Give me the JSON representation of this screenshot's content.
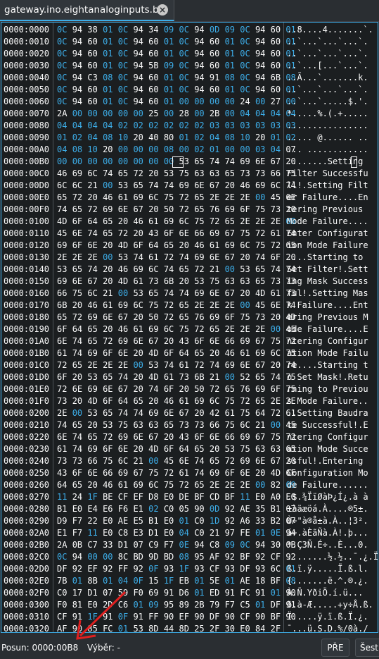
{
  "tab": {
    "title": "gateway.ino.eightanaloginputs.bin"
  },
  "hex_rows": [
    {
      "offset": "0000:0000",
      "bytes": [
        "0C",
        "94",
        "38",
        "01",
        "0C",
        "94",
        "34",
        "09",
        "0C",
        "94",
        "0D",
        "09",
        "0C",
        "94",
        "60",
        "01"
      ],
      "ascii": "..8....4.......`."
    },
    {
      "offset": "0000:0010",
      "bytes": [
        "0C",
        "94",
        "60",
        "01",
        "0C",
        "94",
        "60",
        "01",
        "0C",
        "94",
        "60",
        "01",
        "0C",
        "94",
        "60",
        "01"
      ],
      "ascii": "..`...`...`...`."
    },
    {
      "offset": "0000:0020",
      "bytes": [
        "0C",
        "94",
        "60",
        "01",
        "0C",
        "94",
        "60",
        "01",
        "0C",
        "94",
        "60",
        "01",
        "0C",
        "94",
        "60",
        "01"
      ],
      "ascii": "..`...`...`...`."
    },
    {
      "offset": "0000:0030",
      "bytes": [
        "0C",
        "94",
        "60",
        "01",
        "0C",
        "94",
        "5B",
        "09",
        "0C",
        "94",
        "60",
        "01",
        "0C",
        "94",
        "60",
        "01"
      ],
      "ascii": "..`...[...`...`."
    },
    {
      "offset": "0000:0040",
      "bytes": [
        "0C",
        "94",
        "C3",
        "08",
        "0C",
        "94",
        "60",
        "01",
        "0C",
        "94",
        "91",
        "08",
        "0C",
        "94",
        "6B",
        "08"
      ],
      "ascii": "..Ã...`.......k."
    },
    {
      "offset": "0000:0050",
      "bytes": [
        "0C",
        "94",
        "60",
        "01",
        "0C",
        "94",
        "60",
        "01",
        "0C",
        "94",
        "60",
        "01",
        "0C",
        "94",
        "60",
        "01"
      ],
      "ascii": "..`...`...`...`."
    },
    {
      "offset": "0000:0060",
      "bytes": [
        "0C",
        "94",
        "60",
        "01",
        "0C",
        "94",
        "60",
        "01",
        "00",
        "00",
        "00",
        "00",
        "24",
        "00",
        "27",
        "00"
      ],
      "ascii": "..`...`.....$.'."
    },
    {
      "offset": "0000:0070",
      "bytes": [
        "2A",
        "00",
        "00",
        "00",
        "00",
        "00",
        "25",
        "00",
        "28",
        "00",
        "2B",
        "00",
        "04",
        "04",
        "04",
        "04"
      ],
      "ascii": "*.....%.(.+....."
    },
    {
      "offset": "0000:0080",
      "bytes": [
        "04",
        "04",
        "04",
        "04",
        "02",
        "02",
        "02",
        "02",
        "02",
        "02",
        "03",
        "03",
        "03",
        "03",
        "03",
        "03"
      ],
      "ascii": "................"
    },
    {
      "offset": "0000:0090",
      "bytes": [
        "01",
        "02",
        "04",
        "08",
        "10",
        "20",
        "40",
        "80",
        "01",
        "02",
        "04",
        "08",
        "10",
        "20",
        "01",
        "02"
      ],
      "ascii": "..... @...... .."
    },
    {
      "offset": "0000:00A0",
      "bytes": [
        "04",
        "08",
        "10",
        "20",
        "00",
        "00",
        "00",
        "08",
        "00",
        "02",
        "01",
        "00",
        "00",
        "03",
        "04",
        "07"
      ],
      "ascii": "... ............"
    },
    {
      "offset": "0000:00B0",
      "bytes": [
        "00",
        "00",
        "00",
        "00",
        "00",
        "00",
        "00",
        "00",
        "53",
        "65",
        "74",
        "74",
        "69",
        "6E",
        "67",
        "20"
      ],
      "ascii": "........Setting "
    },
    {
      "offset": "0000:00C0",
      "bytes": [
        "46",
        "69",
        "6C",
        "74",
        "65",
        "72",
        "20",
        "53",
        "75",
        "63",
        "63",
        "65",
        "73",
        "73",
        "66",
        "75"
      ],
      "ascii": "Filter Successfu"
    },
    {
      "offset": "0000:00D0",
      "bytes": [
        "6C",
        "6C",
        "21",
        "00",
        "53",
        "65",
        "74",
        "74",
        "69",
        "6E",
        "67",
        "20",
        "46",
        "69",
        "6C",
        "74"
      ],
      "ascii": "ll!.Setting Filt"
    },
    {
      "offset": "0000:00E0",
      "bytes": [
        "65",
        "72",
        "20",
        "46",
        "61",
        "69",
        "6C",
        "75",
        "72",
        "65",
        "2E",
        "2E",
        "2E",
        "00",
        "45",
        "6E"
      ],
      "ascii": "er Failure....En"
    },
    {
      "offset": "0000:00F0",
      "bytes": [
        "74",
        "65",
        "72",
        "69",
        "6E",
        "67",
        "20",
        "50",
        "72",
        "65",
        "76",
        "69",
        "6F",
        "75",
        "73",
        "20"
      ],
      "ascii": "tering Previous "
    },
    {
      "offset": "0000:0100",
      "bytes": [
        "4D",
        "6F",
        "64",
        "65",
        "20",
        "46",
        "61",
        "69",
        "6C",
        "75",
        "72",
        "65",
        "2E",
        "2E",
        "2E",
        "00"
      ],
      "ascii": "Mode Failure...."
    },
    {
      "offset": "0000:0110",
      "bytes": [
        "45",
        "6E",
        "74",
        "65",
        "72",
        "20",
        "43",
        "6F",
        "6E",
        "66",
        "69",
        "67",
        "75",
        "72",
        "61",
        "74"
      ],
      "ascii": "Enter Configurat"
    },
    {
      "offset": "0000:0120",
      "bytes": [
        "69",
        "6F",
        "6E",
        "20",
        "4D",
        "6F",
        "64",
        "65",
        "20",
        "46",
        "61",
        "69",
        "6C",
        "75",
        "72",
        "65"
      ],
      "ascii": "ion Mode Failure"
    },
    {
      "offset": "0000:0130",
      "bytes": [
        "2E",
        "2E",
        "2E",
        "00",
        "53",
        "74",
        "61",
        "72",
        "74",
        "69",
        "6E",
        "67",
        "20",
        "74",
        "6F",
        "20"
      ],
      "ascii": "....Starting to "
    },
    {
      "offset": "0000:0140",
      "bytes": [
        "53",
        "65",
        "74",
        "20",
        "46",
        "69",
        "6C",
        "74",
        "65",
        "72",
        "21",
        "00",
        "53",
        "65",
        "74",
        "74"
      ],
      "ascii": "Set Filter!.Sett"
    },
    {
      "offset": "0000:0150",
      "bytes": [
        "69",
        "6E",
        "67",
        "20",
        "4D",
        "61",
        "73",
        "6B",
        "20",
        "53",
        "75",
        "63",
        "63",
        "65",
        "73",
        "73"
      ],
      "ascii": "ing Mask Success"
    },
    {
      "offset": "0000:0160",
      "bytes": [
        "66",
        "75",
        "6C",
        "21",
        "00",
        "53",
        "65",
        "74",
        "74",
        "69",
        "6E",
        "67",
        "20",
        "4D",
        "61",
        "73"
      ],
      "ascii": "ful!.Setting Mas"
    },
    {
      "offset": "0000:0170",
      "bytes": [
        "6B",
        "20",
        "46",
        "61",
        "69",
        "6C",
        "75",
        "72",
        "65",
        "2E",
        "2E",
        "2E",
        "00",
        "45",
        "6E",
        "74"
      ],
      "ascii": "k Failure....Ent"
    },
    {
      "offset": "0000:0180",
      "bytes": [
        "65",
        "72",
        "69",
        "6E",
        "67",
        "20",
        "50",
        "72",
        "65",
        "76",
        "69",
        "6F",
        "75",
        "73",
        "20",
        "4D"
      ],
      "ascii": "ering Previous M"
    },
    {
      "offset": "0000:0190",
      "bytes": [
        "6F",
        "64",
        "65",
        "20",
        "46",
        "61",
        "69",
        "6C",
        "75",
        "72",
        "65",
        "2E",
        "2E",
        "2E",
        "00",
        "45"
      ],
      "ascii": "ode Failure....E"
    },
    {
      "offset": "0000:01A0",
      "bytes": [
        "6E",
        "74",
        "65",
        "72",
        "69",
        "6E",
        "67",
        "20",
        "43",
        "6F",
        "6E",
        "66",
        "69",
        "67",
        "75",
        "72"
      ],
      "ascii": "ntering Configur"
    },
    {
      "offset": "0000:01B0",
      "bytes": [
        "61",
        "74",
        "69",
        "6F",
        "6E",
        "20",
        "4D",
        "6F",
        "64",
        "65",
        "20",
        "46",
        "61",
        "69",
        "6C",
        "75"
      ],
      "ascii": "ation Mode Failu"
    },
    {
      "offset": "0000:01C0",
      "bytes": [
        "72",
        "65",
        "2E",
        "2E",
        "2E",
        "00",
        "53",
        "74",
        "61",
        "72",
        "74",
        "69",
        "6E",
        "67",
        "20",
        "74"
      ],
      "ascii": "re....Starting t"
    },
    {
      "offset": "0000:01D0",
      "bytes": [
        "6F",
        "20",
        "53",
        "65",
        "74",
        "20",
        "4D",
        "61",
        "73",
        "6B",
        "21",
        "00",
        "52",
        "65",
        "74",
        "75"
      ],
      "ascii": "o Set Mask!.Retu"
    },
    {
      "offset": "0000:01E0",
      "bytes": [
        "72",
        "6E",
        "69",
        "6E",
        "67",
        "20",
        "74",
        "6F",
        "20",
        "50",
        "72",
        "65",
        "76",
        "69",
        "6F",
        "75"
      ],
      "ascii": "rning to Previou"
    },
    {
      "offset": "0000:01F0",
      "bytes": [
        "73",
        "20",
        "4D",
        "6F",
        "64",
        "65",
        "20",
        "46",
        "61",
        "69",
        "6C",
        "75",
        "72",
        "65",
        "2E",
        "2E"
      ],
      "ascii": "s Mode Failure.."
    },
    {
      "offset": "0000:0200",
      "bytes": [
        "2E",
        "00",
        "53",
        "65",
        "74",
        "74",
        "69",
        "6E",
        "67",
        "20",
        "42",
        "61",
        "75",
        "64",
        "72",
        "61"
      ],
      "ascii": "..Setting Baudra"
    },
    {
      "offset": "0000:0210",
      "bytes": [
        "74",
        "65",
        "20",
        "53",
        "75",
        "63",
        "63",
        "65",
        "73",
        "73",
        "66",
        "75",
        "6C",
        "21",
        "00",
        "45"
      ],
      "ascii": "te Successful!.E"
    },
    {
      "offset": "0000:0220",
      "bytes": [
        "6E",
        "74",
        "65",
        "72",
        "69",
        "6E",
        "67",
        "20",
        "43",
        "6F",
        "6E",
        "66",
        "69",
        "67",
        "75",
        "72"
      ],
      "ascii": "ntering Configur"
    },
    {
      "offset": "0000:0230",
      "bytes": [
        "61",
        "74",
        "69",
        "6F",
        "6E",
        "20",
        "4D",
        "6F",
        "64",
        "65",
        "20",
        "53",
        "75",
        "63",
        "63",
        "65"
      ],
      "ascii": "ation Mode Succe"
    },
    {
      "offset": "0000:0240",
      "bytes": [
        "73",
        "73",
        "66",
        "75",
        "6C",
        "21",
        "00",
        "45",
        "6E",
        "74",
        "65",
        "72",
        "69",
        "6E",
        "67",
        "20"
      ],
      "ascii": "ssful!.Entering "
    },
    {
      "offset": "0000:0250",
      "bytes": [
        "43",
        "6F",
        "6E",
        "66",
        "69",
        "67",
        "75",
        "72",
        "61",
        "74",
        "69",
        "6F",
        "6E",
        "20",
        "4D",
        "6F"
      ],
      "ascii": "Configuration Mo"
    },
    {
      "offset": "0000:0260",
      "bytes": [
        "64",
        "65",
        "20",
        "46",
        "61",
        "69",
        "6C",
        "75",
        "72",
        "65",
        "2E",
        "2E",
        "2E",
        "00",
        "82",
        "09"
      ],
      "ascii": "de Failure......"
    },
    {
      "offset": "0000:0270",
      "bytes": [
        "11",
        "24",
        "1F",
        "BE",
        "CF",
        "EF",
        "D8",
        "E0",
        "DE",
        "BF",
        "CD",
        "BF",
        "11",
        "E0",
        "A0",
        "E0"
      ],
      "ascii": ".$.¾ÏïØàÞ¿Í¿.à à"
    },
    {
      "offset": "0000:0280",
      "bytes": [
        "B1",
        "E0",
        "E4",
        "E6",
        "F6",
        "E1",
        "02",
        "C0",
        "05",
        "90",
        "0D",
        "92",
        "AE",
        "35",
        "B1",
        "07"
      ],
      "ascii": "±àäæöá.À....®5±."
    },
    {
      "offset": "0000:0290",
      "bytes": [
        "D9",
        "F7",
        "22",
        "E0",
        "AE",
        "E5",
        "B1",
        "E0",
        "01",
        "C0",
        "1D",
        "92",
        "A6",
        "33",
        "B2",
        "07"
      ],
      "ascii": "Ù÷\"à®å±à.À..¦3²."
    },
    {
      "offset": "0000:02A0",
      "bytes": [
        "E1",
        "F7",
        "11",
        "E0",
        "C8",
        "E3",
        "D1",
        "E0",
        "04",
        "C0",
        "21",
        "97",
        "FE",
        "01",
        "0E",
        "94"
      ],
      "ascii": "á÷.àÈãÑà.À!.þ..."
    },
    {
      "offset": "0000:02B0",
      "bytes": [
        "2A",
        "0B",
        "C7",
        "33",
        "D1",
        "07",
        "C9",
        "F7",
        "0E",
        "94",
        "C8",
        "09",
        "0C",
        "94",
        "30",
        "0B"
      ],
      "ascii": "*.Ç3Ñ.É÷..È...0."
    },
    {
      "offset": "0000:02C0",
      "bytes": [
        "0C",
        "94",
        "00",
        "00",
        "8C",
        "BD",
        "9D",
        "BD",
        "08",
        "95",
        "AF",
        "92",
        "BF",
        "92",
        "CF",
        "92"
      ],
      "ascii": "........½.½..¯.¿.Ï."
    },
    {
      "offset": "0000:02D0",
      "bytes": [
        "DF",
        "92",
        "EF",
        "92",
        "FF",
        "92",
        "0F",
        "93",
        "1F",
        "93",
        "CF",
        "93",
        "DF",
        "93",
        "6C",
        "01"
      ],
      "ascii": "ß.ï.ÿ.....Ï.ß.l."
    },
    {
      "offset": "0000:02E0",
      "bytes": [
        "7B",
        "01",
        "8B",
        "01",
        "04",
        "0F",
        "15",
        "1F",
        "EB",
        "01",
        "5E",
        "01",
        "AE",
        "18",
        "BF",
        "08"
      ],
      "ascii": "{.......ë.^.®.¿."
    },
    {
      "offset": "0000:02F0",
      "bytes": [
        "C0",
        "17",
        "D1",
        "07",
        "59",
        "F0",
        "69",
        "91",
        "D6",
        "01",
        "ED",
        "91",
        "FC",
        "91",
        "01",
        "90"
      ],
      "ascii": "À.Ñ.YðiÖ.í.ü..."
    },
    {
      "offset": "0000:0300",
      "bytes": [
        "F0",
        "81",
        "E0",
        "2D",
        "C6",
        "01",
        "09",
        "95",
        "89",
        "2B",
        "79",
        "F7",
        "C5",
        "01",
        "DF",
        "91"
      ],
      "ascii": "ð.à-Æ.....+y÷Å.ß."
    },
    {
      "offset": "0000:0310",
      "bytes": [
        "CF",
        "91",
        "1F",
        "91",
        "0F",
        "91",
        "FF",
        "90",
        "EF",
        "90",
        "DF",
        "90",
        "CF",
        "90",
        "BF",
        "90"
      ],
      "ascii": "Ï.....ÿ.ï.ß.Ï.¿."
    },
    {
      "offset": "0000:0320",
      "bytes": [
        "AF",
        "90",
        "85",
        "FC",
        "01",
        "53",
        "8D",
        "44",
        "8D",
        "25",
        "2F",
        "30",
        "E0",
        "84",
        "2F"
      ],
      "ascii": "¯...ü.S.D.%/0à./"
    }
  ],
  "status": {
    "position_label": "Posun:",
    "position_value": "0000:00B8",
    "selection_label": "Výběr:",
    "selection_value": "-",
    "prev_button": "PŘE",
    "next_button": "Šestn"
  },
  "colors": {
    "accent": "#3daee9",
    "zero_byte": "#3daee9",
    "arrow": "#e02020"
  }
}
